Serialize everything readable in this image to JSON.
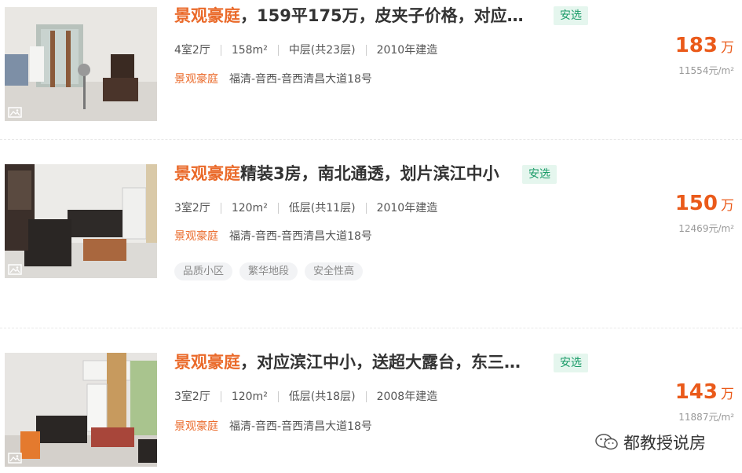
{
  "listings": [
    {
      "title_hl": "景观豪庭",
      "title_rest": "，159平175万，皮夹子价格，对应…",
      "badge": "安选",
      "layout": "4室2厅",
      "area": "158m²",
      "floor": "中层(共23层)",
      "year": "2010年建造",
      "community": "景观豪庭",
      "location": "福清-音西-音西清昌大道18号",
      "tags": [],
      "price": "183",
      "price_unit": "万",
      "unit_price": "11554元/m²"
    },
    {
      "title_hl": "景观豪庭",
      "title_rest": "精装3房，南北通透，划片滨江中小",
      "badge": "安选",
      "layout": "3室2厅",
      "area": "120m²",
      "floor": "低层(共11层)",
      "year": "2010年建造",
      "community": "景观豪庭",
      "location": "福清-音西-音西清昌大道18号",
      "tags": [
        "品质小区",
        "繁华地段",
        "安全性高"
      ],
      "price": "150",
      "price_unit": "万",
      "unit_price": "12469元/m²"
    },
    {
      "title_hl": "景观豪庭",
      "title_rest": "，对应滨江中小，送超大露台，东三…",
      "badge": "安选",
      "layout": "3室2厅",
      "area": "120m²",
      "floor": "低层(共18层)",
      "year": "2008年建造",
      "community": "景观豪庭",
      "location": "福清-音西-音西清昌大道18号",
      "tags": [],
      "price": "143",
      "price_unit": "万",
      "unit_price": "11887元/m²"
    }
  ],
  "watermark": "都教授说房",
  "icons": {
    "gallery": "image-gallery-icon",
    "wechat": "wechat-icon"
  },
  "colors": {
    "highlight": "#ea6a2a",
    "price": "#ea5a1a",
    "badge_text": "#1a9b68",
    "badge_bg": "#e5f6ee"
  }
}
